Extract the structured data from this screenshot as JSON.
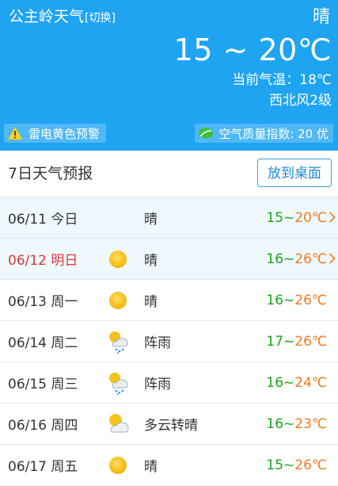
{
  "header": {
    "city": "公主岭天气",
    "switch_label": "[切换]",
    "condition": "晴",
    "temp_range": "15 ~ 20℃",
    "current_temp": "当前气温：18℃",
    "wind": "西北风2级",
    "alert": "雷电黄色预警",
    "aqi": "空气质量指数: 20 优"
  },
  "forecast": {
    "title": "7日天气预报",
    "desk_button": "放到桌面",
    "days": [
      {
        "date": "06/11 今日",
        "icon": "moon-icon",
        "cond": "晴",
        "low": "15",
        "high": "20℃",
        "arrow": true
      },
      {
        "date": "06/12 明日",
        "icon": "sun-icon",
        "cond": "晴",
        "low": "16",
        "high": "26℃",
        "arrow": true
      },
      {
        "date": "06/13 周一",
        "icon": "sun-icon",
        "cond": "晴",
        "low": "16",
        "high": "26℃",
        "arrow": false
      },
      {
        "date": "06/14 周二",
        "icon": "shower-icon",
        "cond": "阵雨",
        "low": "17",
        "high": "26℃",
        "arrow": false
      },
      {
        "date": "06/15 周三",
        "icon": "shower-icon",
        "cond": "阵雨",
        "low": "16",
        "high": "24℃",
        "arrow": false
      },
      {
        "date": "06/16 周四",
        "icon": "cloudy-sun-icon",
        "cond": "多云转晴",
        "low": "16",
        "high": "23℃",
        "arrow": false
      },
      {
        "date": "06/17 周五",
        "icon": "sun-icon",
        "cond": "晴",
        "low": "15",
        "high": "26℃",
        "arrow": false
      }
    ]
  },
  "colors": {
    "header_bg": "#1fa4f1",
    "low_temp": "#1aa51a",
    "high_temp": "#f07a1e",
    "tomorrow_date": "#d83a3a",
    "sun": "#f5c21b"
  }
}
